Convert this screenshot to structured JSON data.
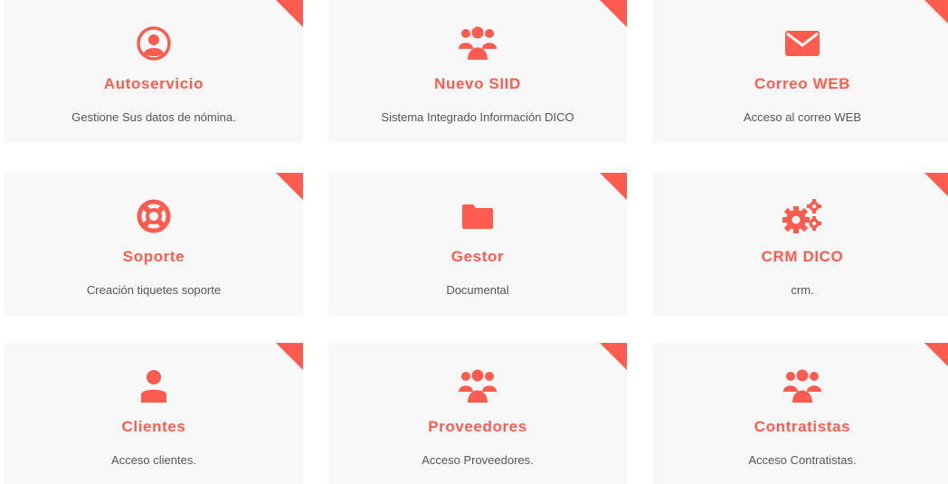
{
  "accent_color": "#ff5c4f",
  "card_background": "#f8f8f8",
  "cards": [
    {
      "title": "Autoservicio",
      "description": "Gestione Sus datos de nómina.",
      "icon": "user-circle-icon"
    },
    {
      "title": "Nuevo SIID",
      "description": "Sistema Integrado Información DICO",
      "icon": "users-icon"
    },
    {
      "title": "Correo WEB",
      "description": "Acceso al correo WEB",
      "icon": "envelope-icon"
    },
    {
      "title": "Soporte",
      "description": "Creación tiquetes soporte",
      "icon": "life-ring-icon"
    },
    {
      "title": "Gestor",
      "description": "Documental",
      "icon": "folder-icon"
    },
    {
      "title": "CRM DICO",
      "description": "crm.",
      "icon": "cogs-icon"
    },
    {
      "title": "Clientes",
      "description": "Acceso clientes.",
      "icon": "user-icon"
    },
    {
      "title": "Proveedores",
      "description": "Acceso Proveedores.",
      "icon": "users-icon"
    },
    {
      "title": "Contratistas",
      "description": "Acceso Contratistas.",
      "icon": "users-icon"
    }
  ]
}
